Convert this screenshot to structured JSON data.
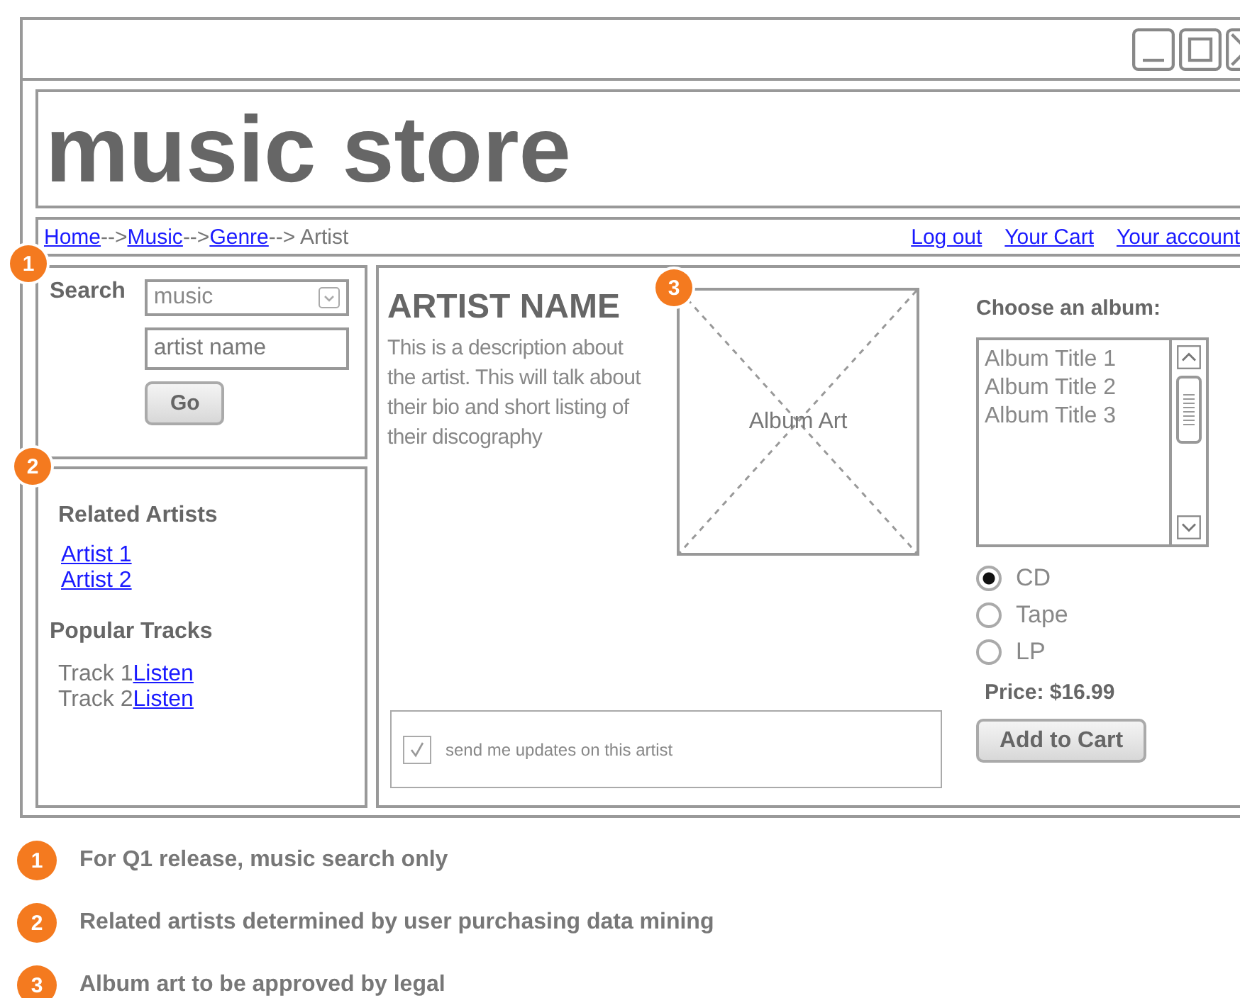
{
  "header": {
    "title": "music store"
  },
  "breadcrumb": {
    "separator": "-->",
    "items": [
      {
        "label": "Home",
        "link": true
      },
      {
        "label": "Music",
        "link": true
      },
      {
        "label": "Genre",
        "link": true
      },
      {
        "label": " Artist",
        "link": false
      }
    ]
  },
  "account_links": [
    "Log out",
    "Your Cart",
    "Your account"
  ],
  "search": {
    "marker": "1",
    "label": "Search",
    "category": "music",
    "query": "artist name",
    "button": "Go"
  },
  "related": {
    "marker": "2",
    "title": "Related Artists",
    "artists": [
      "Artist 1",
      "Artist 2"
    ]
  },
  "popular": {
    "title": "Popular Tracks",
    "tracks": [
      {
        "name": "Track 1",
        "action": "Listen"
      },
      {
        "name": "Track 2",
        "action": "Listen"
      }
    ]
  },
  "artist": {
    "name": "ARTIST NAME",
    "description": "This is a description about the artist.  This will talk about their bio and short listing of their discography"
  },
  "album_art": {
    "marker": "3",
    "label": "Album Art"
  },
  "updates": {
    "label": "send me updates on this artist",
    "checked": true
  },
  "album_chooser": {
    "label": "Choose an album:",
    "albums": [
      "Album Title 1",
      "Album Title 2",
      "Album Title 3"
    ]
  },
  "formats": [
    {
      "label": "CD",
      "selected": true
    },
    {
      "label": "Tape",
      "selected": false
    },
    {
      "label": "LP",
      "selected": false
    }
  ],
  "price": "Price: $16.99",
  "add_to_cart": "Add to Cart",
  "notes": [
    {
      "number": "1",
      "text": "For Q1 release, music search only"
    },
    {
      "number": "2",
      "text": "Related artists determined by user purchasing data mining"
    },
    {
      "number": "3",
      "text": "Album art to be approved by legal"
    }
  ]
}
